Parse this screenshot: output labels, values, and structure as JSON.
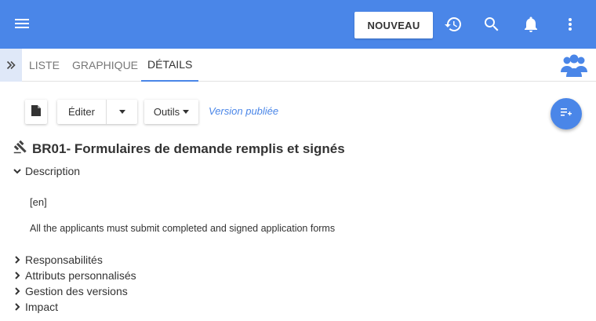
{
  "header": {
    "new_button_label": "NOUVEAU",
    "icons": [
      "menu-icon",
      "history-icon",
      "search-icon",
      "bell-icon",
      "more-vert-icon"
    ],
    "color": "#4a86e8"
  },
  "tabs": [
    {
      "label": "LISTE",
      "active": false
    },
    {
      "label": "GRAPHIQUE",
      "active": false
    },
    {
      "label": "DÉTAILS",
      "active": true
    }
  ],
  "toolbar": {
    "edit_label": "Éditer",
    "tools_label": "Outils",
    "version_status": "Version publiée"
  },
  "record": {
    "title": "BR01- Formulaires de demande remplis et signés",
    "description_section": "Description",
    "language_tag": "[en]",
    "description_text": "All the applicants must submit completed and signed application forms",
    "collapsed_sections": [
      "Responsabilités",
      "Attributs personnalisés",
      "Gestion des versions",
      "Impact"
    ]
  }
}
